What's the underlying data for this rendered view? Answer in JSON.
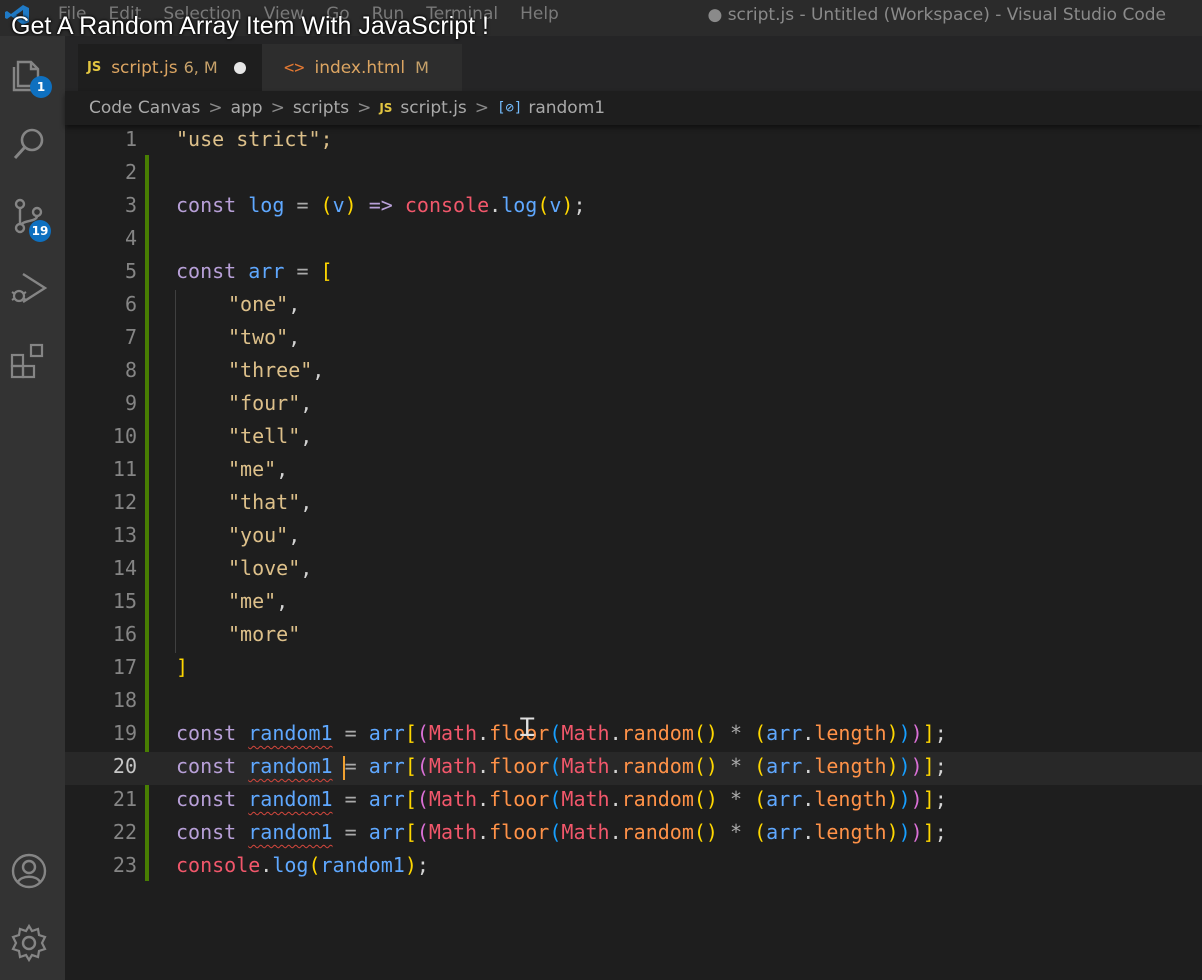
{
  "video_title": "Get A Random Array Item With JavaScript !",
  "window_title": "● script.js - Untitled (Workspace) - Visual Studio Code",
  "menu": [
    "File",
    "Edit",
    "Selection",
    "View",
    "Go",
    "Run",
    "Terminal",
    "Help"
  ],
  "activity": {
    "explorer_badge": "1",
    "scm_badge": "19"
  },
  "tabs": [
    {
      "badge": "JS",
      "name": "script.js",
      "status": "6, M",
      "dirty": true,
      "active": true
    },
    {
      "badge": "<>",
      "name": "index.html",
      "status": "M",
      "dirty": false,
      "active": false
    }
  ],
  "breadcrumb": {
    "items": [
      "Code Canvas",
      "app",
      "scripts"
    ],
    "file_badge": "JS",
    "file": "script.js",
    "symbol_icon": "[⊘]",
    "symbol": "random1",
    "separator": ">"
  },
  "editor": {
    "line_numbers": [
      "1",
      "2",
      "3",
      "4",
      "5",
      "6",
      "7",
      "8",
      "9",
      "10",
      "11",
      "12",
      "13",
      "14",
      "15",
      "16",
      "17",
      "18",
      "19",
      "20",
      "21",
      "22",
      "23"
    ],
    "array_items": [
      "\"one\"",
      "\"two\"",
      "\"three\"",
      "\"four\"",
      "\"tell\"",
      "\"me\"",
      "\"that\"",
      "\"you\"",
      "\"love\"",
      "\"me\"",
      "\"more\""
    ],
    "lines": {
      "l1": "\"use strict\";",
      "l3": {
        "kw": "const",
        "name": "log",
        "eq": "=",
        "param": "v",
        "arrow": "=>",
        "obj": "console",
        "method": "log"
      },
      "l5": {
        "kw": "const",
        "name": "arr",
        "eq": "=",
        "open": "["
      },
      "l17": "]",
      "rand": {
        "kw": "const",
        "name": "random1",
        "eq": "=",
        "arr": "arr",
        "math": "Math",
        "floor": "floor",
        "random": "random",
        "mul": "*",
        "length": "length"
      },
      "l23": {
        "obj": "console",
        "method": "log",
        "arg": "random1"
      }
    },
    "current_line": "20"
  },
  "colors": {
    "keyword": "#c586c0",
    "string": "#ddc08a",
    "variable": "#5fa8ff",
    "function": "#ff7a59",
    "git_modified": "#487e02",
    "badge": "#0e70c0"
  }
}
